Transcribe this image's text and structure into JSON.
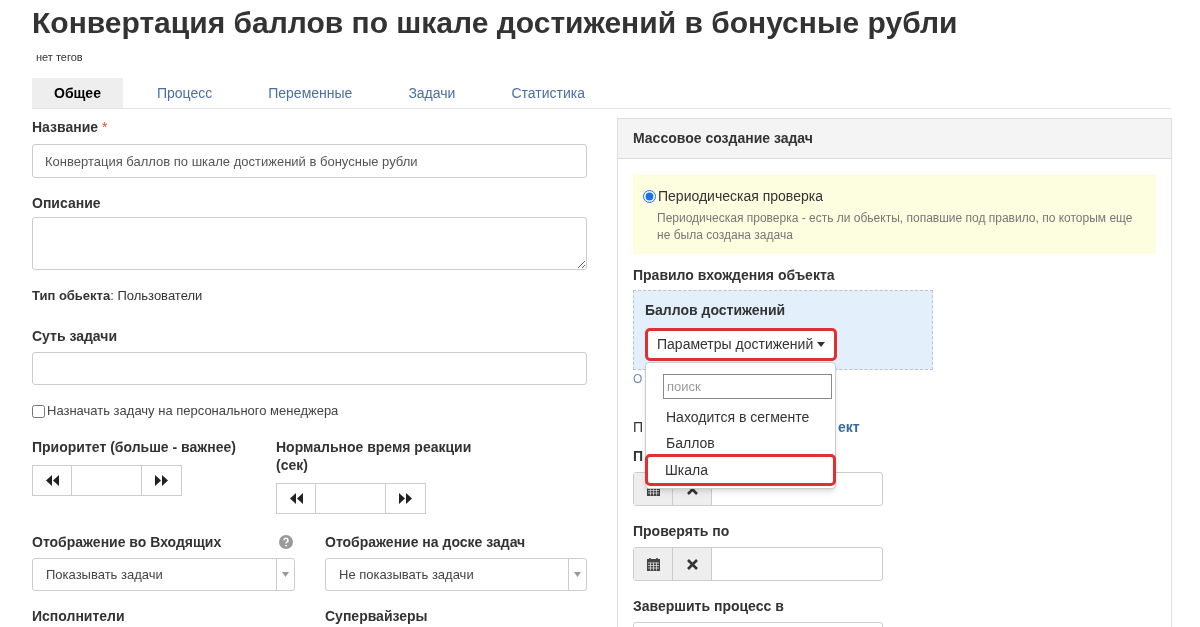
{
  "title": "Конвертация баллов по шкале достижений в бонусные рубли",
  "tags": "нет тегов",
  "tabs": [
    {
      "label": "Общее",
      "selected": true
    },
    {
      "label": "Процесс",
      "selected": false
    },
    {
      "label": "Переменные",
      "selected": false
    },
    {
      "label": "Задачи",
      "selected": false
    },
    {
      "label": "Статистика",
      "selected": false
    }
  ],
  "general": {
    "name": {
      "label": "Название",
      "required_mark": "*",
      "value": "Конвертация баллов по шкале достижений в бонусные рубли"
    },
    "description": {
      "label": "Описание"
    },
    "object_type": {
      "text": "**Тип обьекта**: Пользователи"
    },
    "task_essence": {
      "label": "Суть задачи"
    },
    "assign_personal_manager": {
      "label": "Назначать задачу на персонального менеджера",
      "checked": false
    },
    "priority": {
      "label": "Приоритет (больше - важнее)"
    },
    "reaction_time": {
      "label": "Нормальное время реакции (сек)"
    },
    "inbox_display": {
      "label": "Отображение во Входящих",
      "value": "Показывать задачи"
    },
    "board_display": {
      "label": "Отображение на доске задач",
      "value": "Не показывать задачи"
    },
    "executors": {
      "label": "Исполнители"
    },
    "supervisors": {
      "label": "Супервайзеры"
    }
  },
  "mass_creation": {
    "title": "Массовое создание задач",
    "modes": [
      {
        "label": "Периодическая проверка",
        "selected": true,
        "description": "Периодическая проверка - есть ли обьекты, попавшие под правило, по которым еще не была создана задача"
      }
    ],
    "rule_label": "Правило вхождения объекта",
    "rule": {
      "title": "Баллов достижений",
      "button": {
        "label": "Параметры достижений",
        "highlighted": true
      },
      "menu": {
        "search_placeholder": "поиск",
        "items": [
          {
            "label": "Находится в сегменте",
            "highlighted": false
          },
          {
            "label": "Баллов",
            "highlighted": false
          },
          {
            "label": "Шкала",
            "highlighted": true
          }
        ]
      }
    },
    "covered_link": "О",
    "covered_line": {
      "start": "П",
      "end": "ект"
    },
    "date_fields": [
      {
        "label": "П"
      },
      {
        "label": "Проверять по"
      },
      {
        "label": "Завершить процесс в",
        "cut_off": true
      }
    ]
  }
}
